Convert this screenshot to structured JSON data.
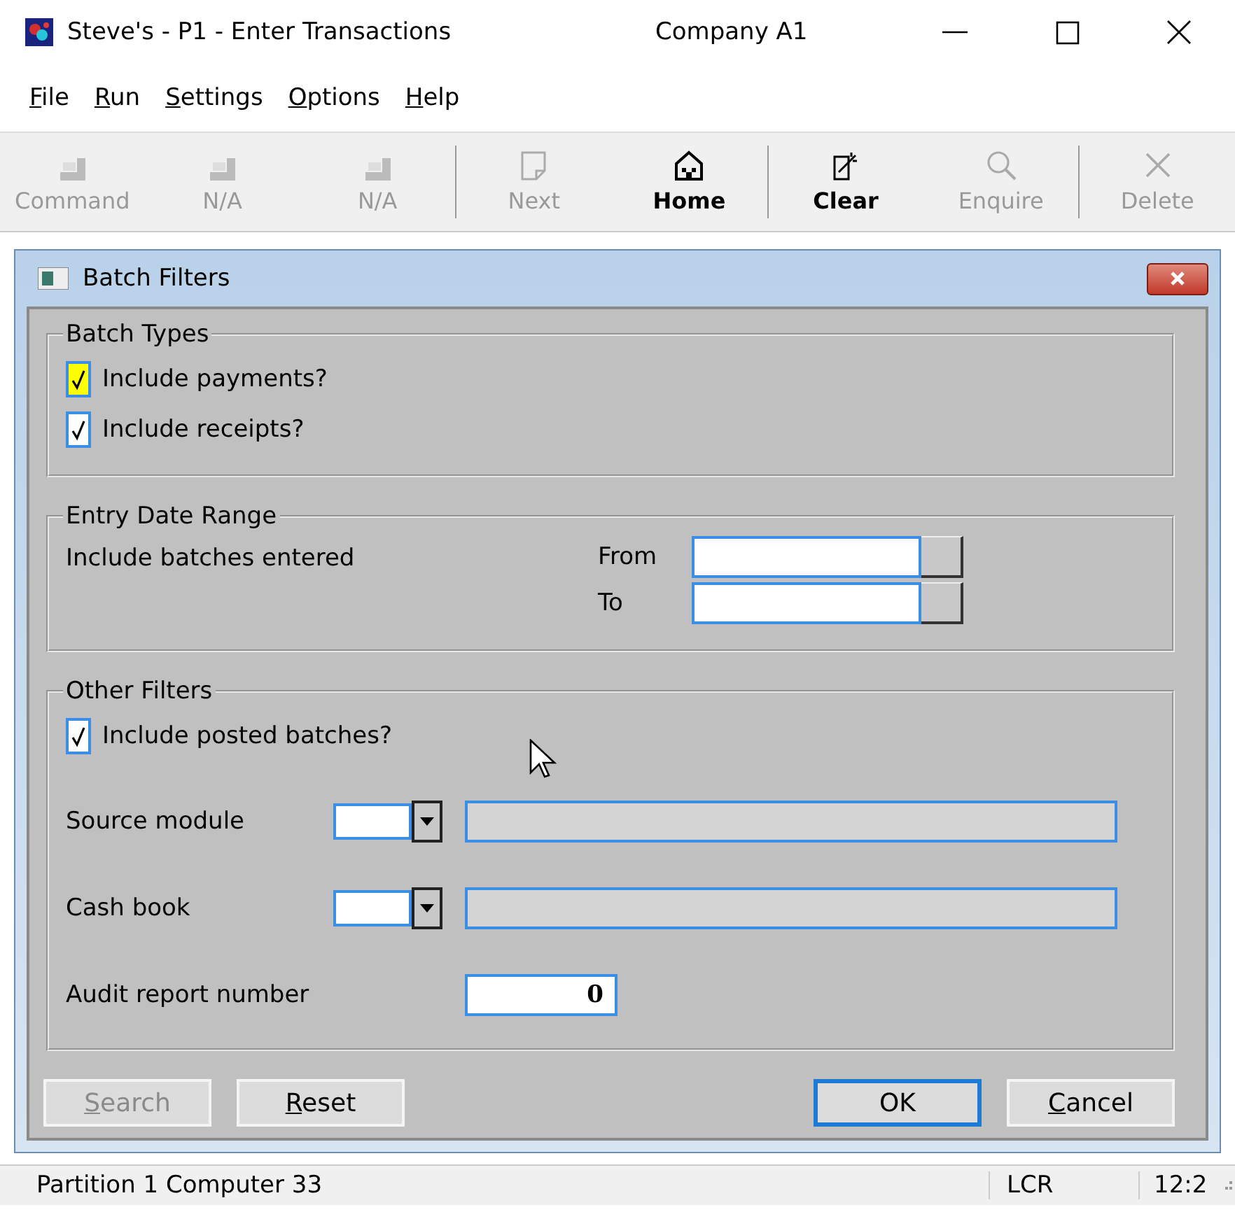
{
  "window": {
    "title": "Steve's - P1 - Enter Transactions",
    "company": "Company A1"
  },
  "menu": [
    {
      "label": "File",
      "mnemonic": true
    },
    {
      "label": "Run",
      "mnemonic": true
    },
    {
      "label": "Settings",
      "mnemonic": true
    },
    {
      "label": "Options",
      "mnemonic": true
    },
    {
      "label": "Help",
      "mnemonic": true
    }
  ],
  "toolbar": [
    {
      "kind": "f1",
      "label": "Command",
      "disabled": true
    },
    {
      "kind": "f2",
      "label": "N/A",
      "disabled": true
    },
    {
      "kind": "f3",
      "label": "N/A",
      "disabled": true,
      "separator_after": true
    },
    {
      "kind": "next",
      "label": "Next",
      "disabled": true
    },
    {
      "kind": "home",
      "label": "Home",
      "disabled": false,
      "separator_after": true
    },
    {
      "kind": "clear",
      "label": "Clear",
      "disabled": false
    },
    {
      "kind": "enquire",
      "label": "Enquire",
      "disabled": true,
      "separator_after": true
    },
    {
      "kind": "delete",
      "label": "Delete",
      "disabled": true
    }
  ],
  "dialog": {
    "title": "Batch Filters",
    "batch_types": {
      "title": "Batch Types",
      "checkboxes": [
        {
          "label": "Include payments?",
          "checked": true,
          "focused": true
        },
        {
          "label": "Include receipts?",
          "checked": true,
          "focused": false
        }
      ]
    },
    "entry_date_range": {
      "title": "Entry Date Range",
      "label": "Include batches entered",
      "fields": [
        {
          "label": "From"
        },
        {
          "label": "To"
        }
      ]
    },
    "other_filters": {
      "title": "Other Filters",
      "checkbox": {
        "label": "Include posted batches?",
        "checked": true,
        "focused": false
      },
      "dropdowns": [
        {
          "label": "Source module"
        },
        {
          "label": "Cash book"
        }
      ],
      "audit": {
        "label": "Audit report number",
        "value": "0"
      }
    },
    "buttons": [
      {
        "label": "Search",
        "mnemonic": true,
        "disabled": true,
        "default": false
      },
      {
        "label": "Reset",
        "mnemonic": true,
        "disabled": false,
        "default": false
      },
      {
        "label": "OK",
        "mnemonic": false,
        "disabled": false,
        "default": true
      },
      {
        "label": "Cancel",
        "mnemonic": true,
        "disabled": false,
        "default": false
      }
    ]
  },
  "status_bar": {
    "message": "Partition 1 Computer 33",
    "mode": "LCR",
    "time": "12:2"
  }
}
